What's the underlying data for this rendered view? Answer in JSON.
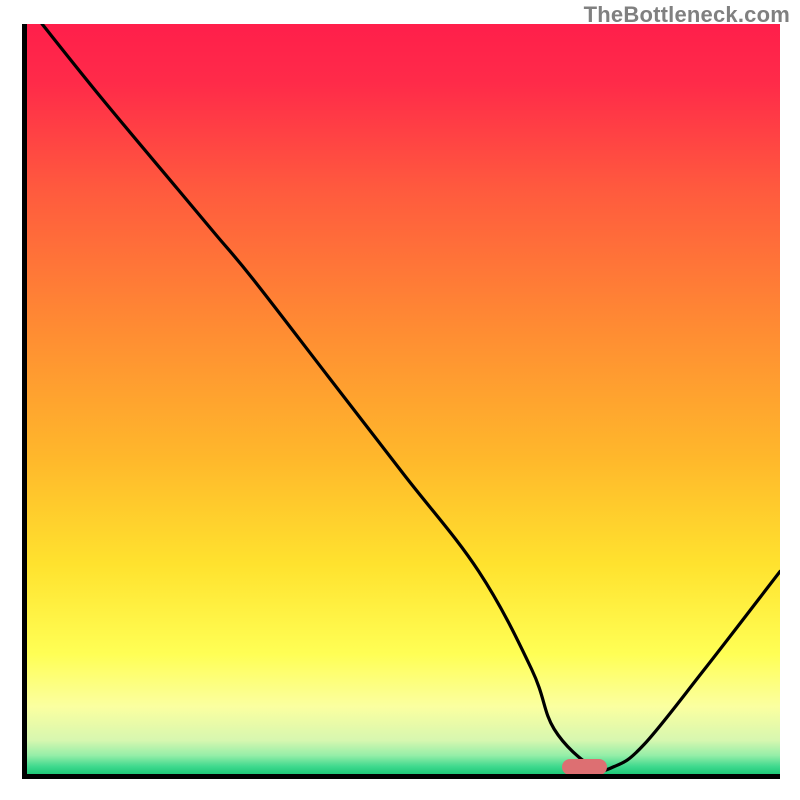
{
  "watermark": "TheBottleneck.com",
  "chart_data": {
    "type": "line",
    "title": "",
    "xlabel": "",
    "ylabel": "",
    "xlim": [
      0,
      100
    ],
    "ylim": [
      0,
      100
    ],
    "grid": false,
    "legend": false,
    "background_gradient_stops": [
      {
        "offset": 0.0,
        "color": "#ff1f4b"
      },
      {
        "offset": 0.08,
        "color": "#ff2b49"
      },
      {
        "offset": 0.22,
        "color": "#ff5a3e"
      },
      {
        "offset": 0.4,
        "color": "#ff8a33"
      },
      {
        "offset": 0.58,
        "color": "#ffb82b"
      },
      {
        "offset": 0.72,
        "color": "#ffe22e"
      },
      {
        "offset": 0.84,
        "color": "#ffff55"
      },
      {
        "offset": 0.91,
        "color": "#fbffa0"
      },
      {
        "offset": 0.955,
        "color": "#d7f7b0"
      },
      {
        "offset": 0.975,
        "color": "#96eea8"
      },
      {
        "offset": 0.99,
        "color": "#3fd98e"
      },
      {
        "offset": 1.0,
        "color": "#1fc877"
      }
    ],
    "series": [
      {
        "name": "bottleneck-curve",
        "x": [
          2,
          10,
          20,
          25,
          30,
          40,
          50,
          60,
          67,
          70,
          75,
          78,
          82,
          90,
          100
        ],
        "y": [
          100,
          90,
          78,
          72,
          66,
          53,
          40,
          27,
          14,
          6,
          1,
          1,
          4,
          14,
          27
        ]
      }
    ],
    "marker": {
      "name": "optimal-range",
      "x_start": 71,
      "x_end": 77,
      "y": 1,
      "color": "#dd6f72"
    }
  }
}
